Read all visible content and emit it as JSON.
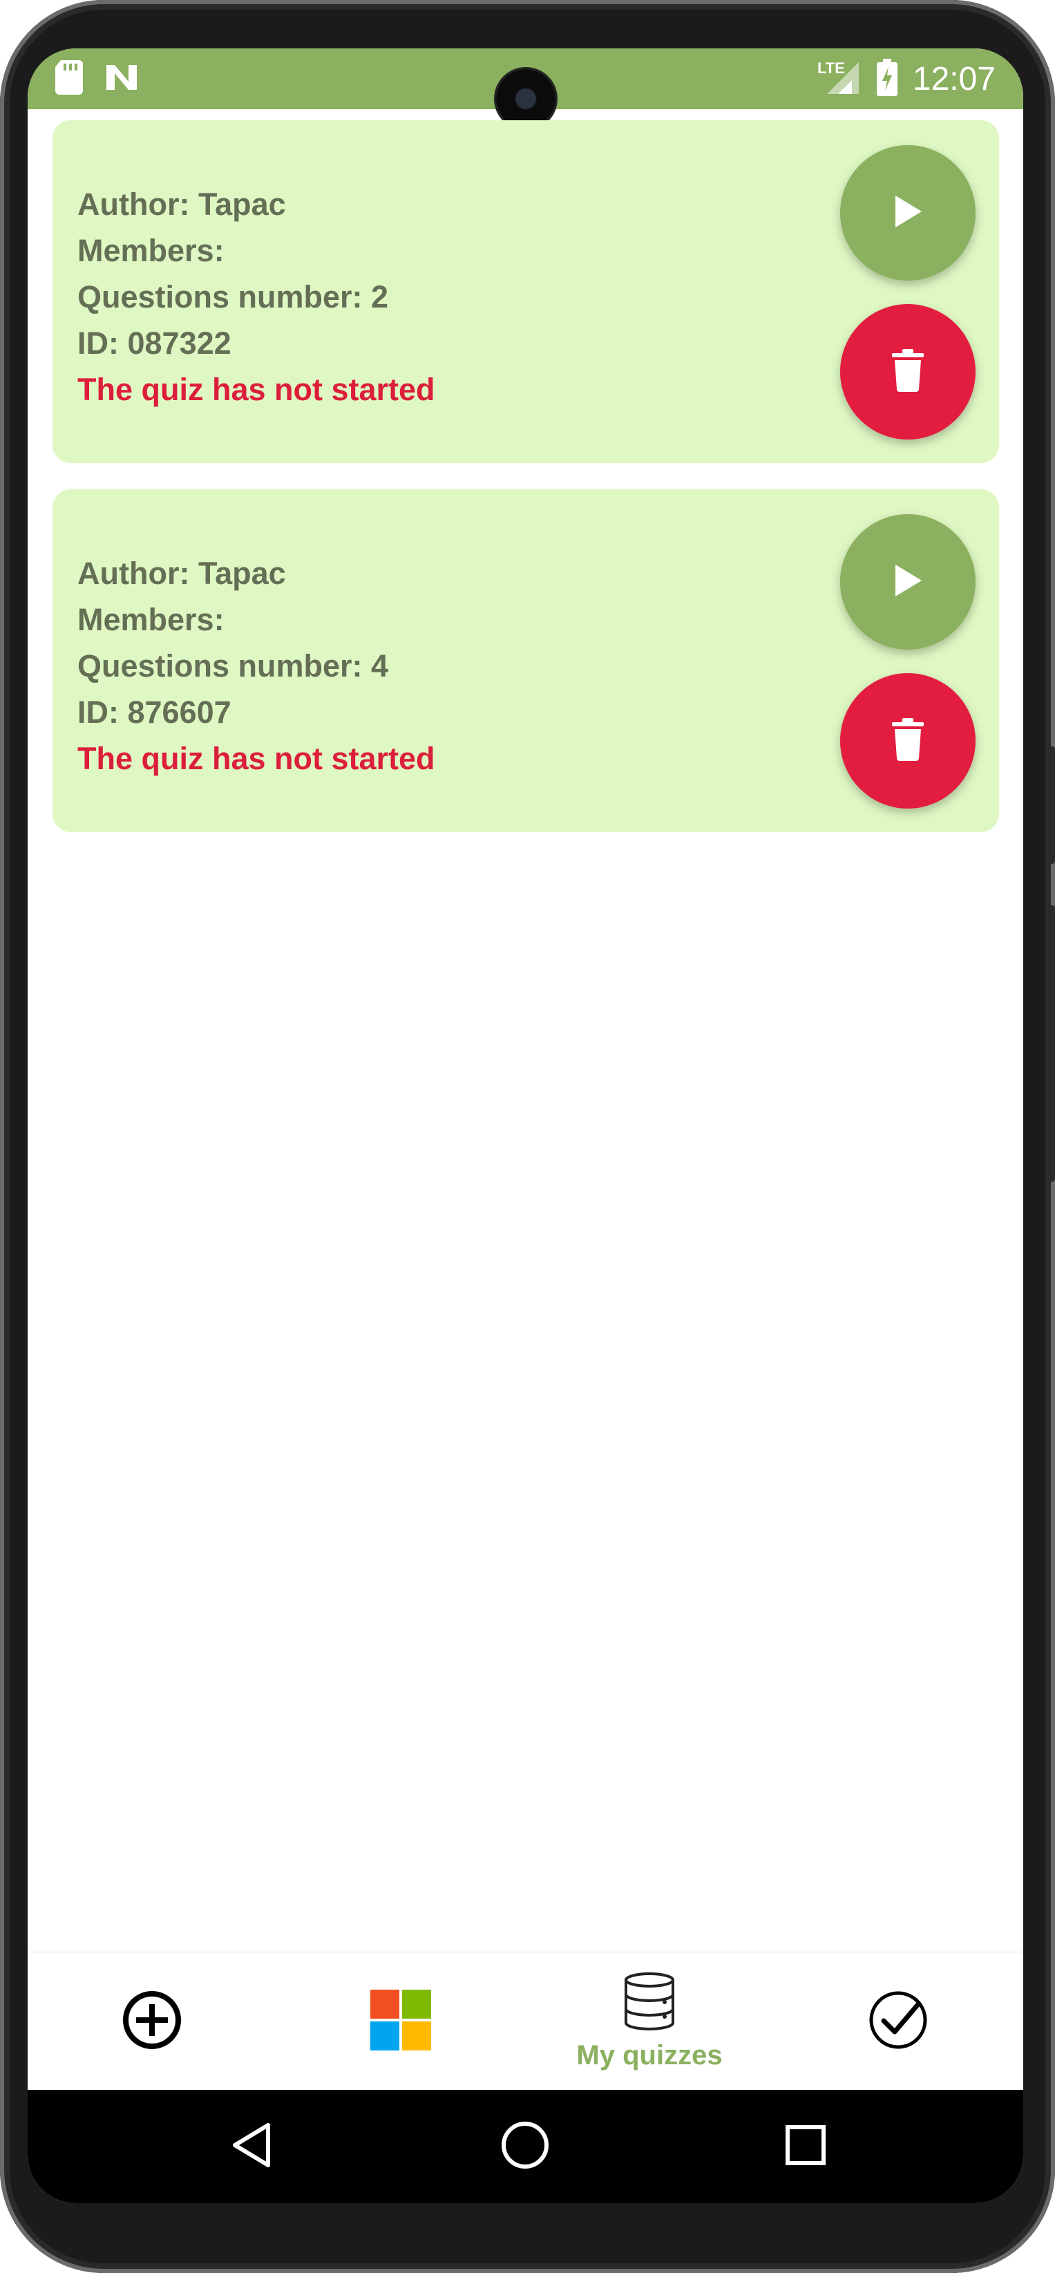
{
  "status_bar": {
    "time": "12:07",
    "network": "LTE",
    "left_icons": [
      "sd-card-icon",
      "n-notification-icon"
    ],
    "right_icons": [
      "signal-icon",
      "battery-charging-icon"
    ],
    "background_color": "#8bb05f"
  },
  "quizzes": [
    {
      "author": "Author: Tapac",
      "members": "Members:",
      "questions": "Questions number: 2",
      "id": "ID: 087322",
      "status": "The quiz has not started"
    },
    {
      "author": "Author: Tapac",
      "members": "Members:",
      "questions": "Questions number: 4",
      "id": "ID: 876607",
      "status": "The quiz has not started"
    }
  ],
  "card_actions": {
    "play_icon": "play-icon",
    "delete_icon": "trash-icon",
    "play_color": "#8bb05f",
    "delete_color": "#e31d3f"
  },
  "bottom_nav": {
    "items": [
      {
        "icon": "add-circle-icon",
        "label": ""
      },
      {
        "icon": "tiles-icon",
        "label": ""
      },
      {
        "icon": "database-icon",
        "label": "My quizzes",
        "selected": true
      },
      {
        "icon": "check-circle-icon",
        "label": ""
      }
    ],
    "accent_color": "#8bb05f"
  },
  "system_nav": {
    "buttons": [
      "back-icon",
      "home-icon",
      "recents-icon"
    ]
  },
  "colors": {
    "card_background": "#dff8c3",
    "info_text": "#646f56",
    "status_text": "#dc1e3c"
  }
}
